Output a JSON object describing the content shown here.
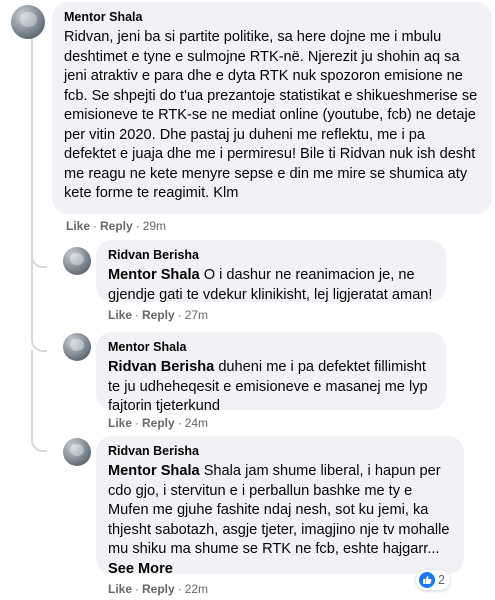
{
  "comments": [
    {
      "author": "Mentor Shala",
      "mention": "",
      "text": "Ridvan, jeni ba si partite politike, sa here dojne me i mbulu deshtimet e tyne e sulmojne RTK-në. Njerezit ju shohin aq sa jeni atraktiv e para dhe e dyta RTK nuk spozoron emisione ne fcb. Se shpejti do t'ua prezantoje statistikat e shikueshmerise se emisioneve te RTK-se ne mediat online (youtube, fcb) ne detaje per vitin 2020. Dhe pastaj ju duheni me reflektu, me i pa defektet e juaja dhe me i permiresu! Bile ti Ridvan nuk ish desht me reagu ne kete menyre sepse e din me mire se shumica aty kete forme te reagimit. Klm",
      "like": "Like",
      "reply": "Reply",
      "time": "29m"
    },
    {
      "author": "Ridvan Berisha",
      "mention": "Mentor Shala",
      "text": "O i dashur ne reanimacion je, ne gjendje gati te vdekur klinikisht, lej ligjeratat aman!",
      "like": "Like",
      "reply": "Reply",
      "time": "27m"
    },
    {
      "author": "Mentor Shala",
      "mention": "Ridvan Berisha",
      "text": "duheni me i pa defektet fillimisht te ju udheheqesit e emisioneve e masanej me lyp fajtorin tjeterkund",
      "like": "Like",
      "reply": "Reply",
      "time": "24m"
    },
    {
      "author": "Ridvan Berisha",
      "mention": "Mentor Shala",
      "text": "Shala jam shume liberal, i hapun per cdo gjo, i stervitun e i perballun bashke me ty e Mufen me gjuhe fashite ndaj nesh, sot ku jemi, ka thjesht sabotazh, asgje tjeter, imagjino nje tv mohalle mu shiku ma shume se RTK ne fcb, eshte hajgarr...",
      "see_more": "See More",
      "like": "Like",
      "reply": "Reply",
      "time": "22m",
      "reaction_count": "2"
    }
  ],
  "colors": {
    "bubble": "#f0f2f5",
    "meta": "#65676b",
    "like_blue": "#1877f2"
  },
  "icons": [
    "avatar",
    "like-icon"
  ]
}
